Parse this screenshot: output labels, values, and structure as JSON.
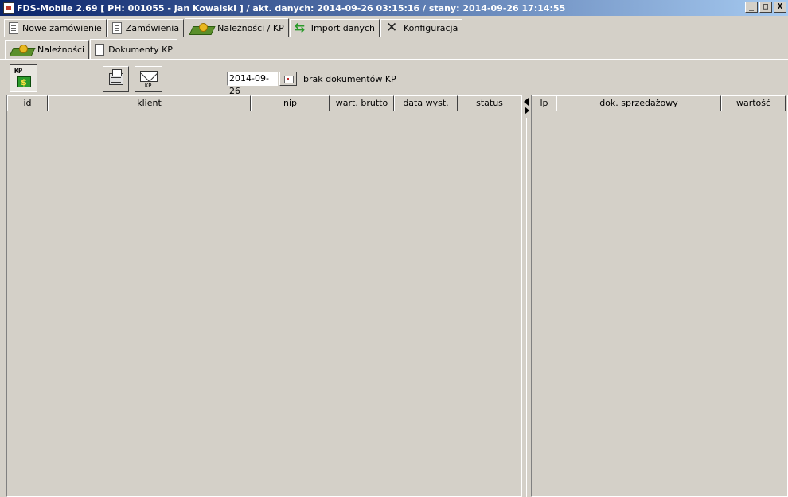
{
  "window": {
    "title": "FDS-Mobile 2.69 [ PH: 001055 - Jan Kowalski ]  / akt. danych: 2014-09-26 03:15:16 / stany: 2014-09-26 17:14:55",
    "minimize": "_",
    "maximize": "□",
    "close": "X"
  },
  "main_tabs": [
    {
      "label": "Nowe zamówienie",
      "icon": "document-icon"
    },
    {
      "label": "Zamówienia",
      "icon": "document-icon"
    },
    {
      "label": "Należności / KP",
      "icon": "money-icon",
      "active": true
    },
    {
      "label": "Import danych",
      "icon": "sync-arrows-icon"
    },
    {
      "label": "Konfiguracja",
      "icon": "tools-icon"
    }
  ],
  "sub_tabs": [
    {
      "label": "Należności",
      "icon": "money-icon"
    },
    {
      "label": "Dokumenty KP",
      "icon": "kp-document-icon",
      "active": true
    }
  ],
  "toolbar": {
    "kp_button_label": "KP",
    "kp_button_symbol": "$",
    "mail_button_label": "KP",
    "date_value": "2014-09-26",
    "status_text": "brak dokumentów KP"
  },
  "left_table": {
    "columns": [
      "id",
      "klient",
      "nip",
      "wart. brutto",
      "data wyst.",
      "status"
    ],
    "rows": []
  },
  "right_table": {
    "columns": [
      "lp",
      "dok. sprzedażowy",
      "wartość"
    ],
    "rows": []
  }
}
